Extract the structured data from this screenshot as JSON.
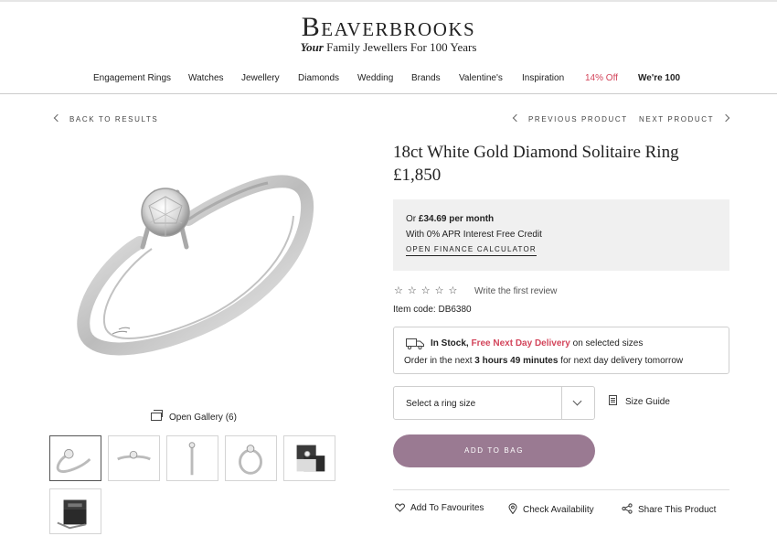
{
  "brand": {
    "name": "Beaverbrooks",
    "tagline_em": "Your",
    "tagline_rest": "Family Jewellers For 100 Years"
  },
  "nav": {
    "items": [
      {
        "label": "Engagement Rings"
      },
      {
        "label": "Watches"
      },
      {
        "label": "Jewellery"
      },
      {
        "label": "Diamonds"
      },
      {
        "label": "Wedding"
      },
      {
        "label": "Brands"
      },
      {
        "label": "Valentine's"
      },
      {
        "label": "Inspiration"
      },
      {
        "label": "14% Off",
        "color": "#d3455b"
      },
      {
        "label": "We're 100"
      }
    ]
  },
  "breadcrumbs": {
    "back": "BACK TO RESULTS",
    "previous": "PREVIOUS PRODUCT",
    "next": "NEXT PRODUCT"
  },
  "gallery": {
    "open_label": "Open Gallery (6)",
    "thumbnails": [
      "ring-angle",
      "ring-side",
      "ring-top",
      "ring-front",
      "ring-box-open",
      "ring-box-closed"
    ],
    "active_index": 0
  },
  "product": {
    "title": "18ct White Gold Diamond Solitaire Ring",
    "price": "£1,850",
    "finance": {
      "prefix": "Or",
      "monthly": "£34.69 per month",
      "apr": "With 0% APR Interest Free Credit",
      "link": "OPEN FINANCE CALCULATOR"
    },
    "rating": {
      "stars": "☆☆☆☆☆",
      "filled": 0,
      "max": 5,
      "review_link": "Write the first review"
    },
    "item_code": "Item code: DB6380",
    "stock": {
      "status": "In Stock,",
      "delivery": "Free Next Day Delivery",
      "delivery_suffix": "on selected sizes",
      "order_prefix": "Order in the next",
      "countdown": "3 hours 49 minutes",
      "order_suffix": "for next day delivery tomorrow"
    },
    "size_select": {
      "placeholder": "Select a ring size"
    },
    "size_guide": "Size Guide",
    "add_to_bag": "ADD TO BAG",
    "actions": {
      "favourites": "Add To Favourites",
      "availability": "Check Availability",
      "share": "Share This Product"
    }
  },
  "colors": {
    "accent_button": "#9a7a92",
    "promo_red": "#d3455b",
    "finance_bg": "#f0f0f0"
  }
}
